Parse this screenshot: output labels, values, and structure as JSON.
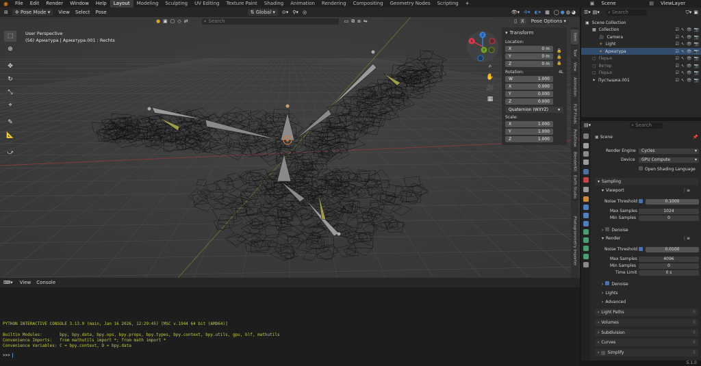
{
  "topbar": {
    "menus": [
      "File",
      "Edit",
      "Render",
      "Window",
      "Help"
    ],
    "tabs": [
      "Layout",
      "Modeling",
      "Sculpting",
      "UV Editing",
      "Texture Paint",
      "Shading",
      "Animation",
      "Rendering",
      "Compositing",
      "Geometry Nodes",
      "Scripting"
    ],
    "scene": "Scene",
    "view_layer": "ViewLayer",
    "add_tab": "+"
  },
  "viewport": {
    "mode": "Pose Mode",
    "menus": [
      "View",
      "Select",
      "Pose"
    ],
    "orientation": "Global",
    "search_placeholder": "Search",
    "pose_options": "Pose Options",
    "overlay_title": "User Perspective",
    "overlay_subtitle": "(56) Арматура | Арматура.001 : Rechts",
    "axes": {
      "x": "X",
      "y": "Y",
      "z": "Z"
    },
    "close": "X"
  },
  "transform": {
    "title": "Transform",
    "location_label": "Location:",
    "location": [
      {
        "axis": "X",
        "value": "0 m"
      },
      {
        "axis": "Y",
        "value": "0 m"
      },
      {
        "axis": "Z",
        "value": "0 m"
      }
    ],
    "rotation_label": "Rotation:",
    "rotation_mode_short": "4L",
    "rotation": [
      {
        "axis": "W",
        "value": "1.000"
      },
      {
        "axis": "X",
        "value": "0.000"
      },
      {
        "axis": "Y",
        "value": "0.000"
      },
      {
        "axis": "Z",
        "value": "0.000"
      }
    ],
    "rotation_mode": "Quaternion (WXYZ)",
    "scale_label": "Scale:",
    "scale": [
      {
        "axis": "X",
        "value": "1.000"
      },
      {
        "axis": "Y",
        "value": "1.000"
      },
      {
        "axis": "Z",
        "value": "1.000"
      }
    ]
  },
  "side_tabs": [
    "Item",
    "Tool",
    "View",
    "Animation",
    "FLIP Fluids",
    "PolyDraw",
    "BlenderKit",
    "Earth Studio",
    "Photogrammetry Importer"
  ],
  "console": {
    "menus": [
      "View",
      "Console"
    ],
    "lines": [
      "PYTHON INTERACTIVE CONSOLE 3.13.9 (main, Jan 16 2026, 12:29:45) [MSC v.1944 64 bit (AMD64)]",
      "",
      "Builtin Modules:       bpy, bpy.data, bpy.ops, bpy.props, bpy.types, bpy.context, bpy.utils, gpu, blf, mathutils",
      "Convenience Imports:   from mathutils import *; from math import *",
      "Convenience Variables: C = bpy.context, D = bpy.data"
    ],
    "prompt": ">>> "
  },
  "outliner": {
    "search_placeholder": "Search",
    "items": [
      {
        "label": "Scene Collection",
        "indent": 0
      },
      {
        "label": "Collection",
        "indent": 1
      },
      {
        "label": "Camera",
        "indent": 2
      },
      {
        "label": "Light",
        "indent": 2
      },
      {
        "label": "Арматура",
        "indent": 2
      },
      {
        "label": "Перья",
        "indent": 1
      },
      {
        "label": "Ветер",
        "indent": 1
      },
      {
        "label": "Перья",
        "indent": 1
      },
      {
        "label": "Пустышка.001",
        "indent": 1
      }
    ]
  },
  "properties": {
    "search_placeholder": "Search",
    "context": "Scene",
    "render_engine_label": "Render Engine",
    "render_engine": "Cycles",
    "device_label": "Device",
    "device": "GPU Compute",
    "osl_label": "Open Shading Language",
    "sampling": "Sampling",
    "viewport": "Viewport",
    "noise_threshold_label": "Noise Threshold",
    "viewport_noise_threshold": "0.1000",
    "max_samples_label": "Max Samples",
    "viewport_max_samples": "1024",
    "min_samples_label": "Min Samples",
    "viewport_min_samples": "0",
    "denoise": "Denoise",
    "render": "Render",
    "render_noise_threshold": "0.0100",
    "render_max_samples": "4096",
    "render_min_samples": "0",
    "time_limit_label": "Time Limit",
    "time_limit": "0 s",
    "render_denoise": "Denoise",
    "lights": "Lights",
    "advanced": "Advanced",
    "light_paths": "Light Paths",
    "volumes": "Volumes",
    "subdivision": "Subdivision",
    "curves": "Curves",
    "simplify": "Simplify"
  },
  "status": {
    "version": "5.1.0"
  },
  "colors": {
    "accent": "#4772b3",
    "active_tab": "#3a3a3a",
    "console_text": "#c4cc3c",
    "axis_x": "#e2384d",
    "axis_y": "#6fa022",
    "axis_z": "#2f83e3"
  }
}
